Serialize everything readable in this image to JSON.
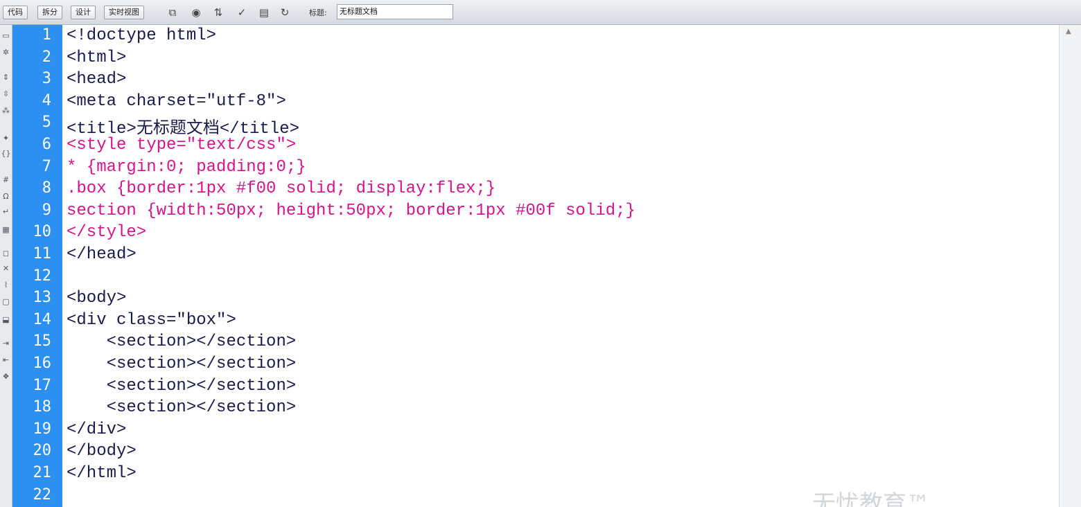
{
  "toolbar": {
    "view_buttons": [
      "代码",
      "拆分",
      "设计",
      "实时视图"
    ],
    "title_label": "标题:",
    "title_value": "无标题文档"
  },
  "code": {
    "line_numbers": [
      "1",
      "2",
      "3",
      "4",
      "5",
      "6",
      "7",
      "8",
      "9",
      "10",
      "11",
      "12",
      "13",
      "14",
      "15",
      "16",
      "17",
      "18",
      "19",
      "20",
      "21",
      "22"
    ],
    "lines": [
      "<!doctype html>",
      "<html>",
      "<head>",
      "<meta charset=\"utf-8\">",
      "<title>无标题文档</title>",
      "<style type=\"text/css\">",
      "* {margin:0; padding:0;}",
      ".box {border:1px #f00 solid; display:flex;}",
      "section {width:50px; height:50px; border:1px #00f solid;}",
      "</style>",
      "</head>",
      "",
      "<body>",
      "<div class=\"box\">",
      "    <section></section>",
      "    <section></section>",
      "    <section></section>",
      "    <section></section>",
      "</div>",
      "</body>",
      "</html>",
      ""
    ]
  },
  "colors": {
    "gutter": "#2d8ff0",
    "css_keyword": "#d4148c",
    "tag_text": "#1a1a4a"
  },
  "watermark": "无忧教育™"
}
